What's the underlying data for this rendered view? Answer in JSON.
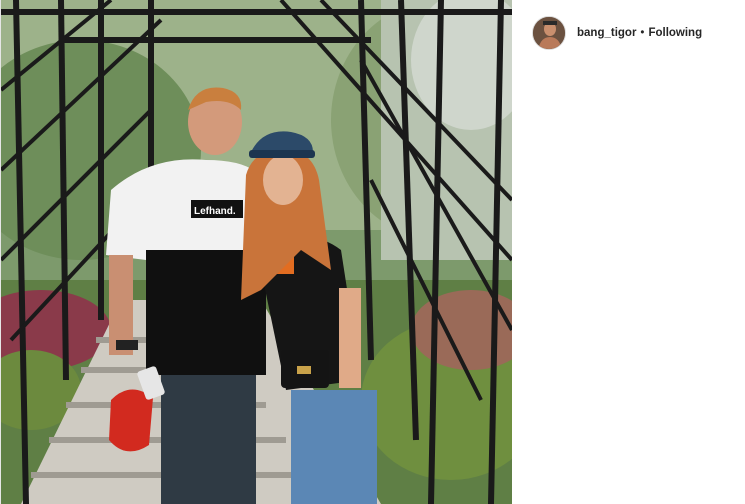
{
  "post": {
    "author": {
      "username": "bang_tigor",
      "avatar_icon": "profile-avatar"
    },
    "separator": "•",
    "follow_status": "Following",
    "photo": {
      "description_icon": "post-photo",
      "shirt_logo_text": "Lefhand."
    }
  },
  "colors": {
    "text": "#262626",
    "border": "#dbdbdb",
    "background": "#ffffff"
  }
}
